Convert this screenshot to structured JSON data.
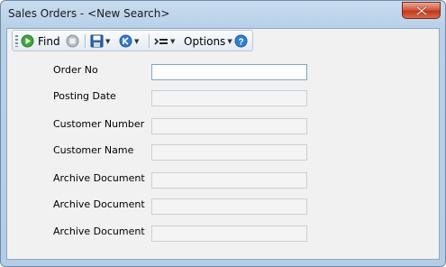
{
  "window": {
    "title": "Sales Orders - <New Search>"
  },
  "toolbar": {
    "find_label": "Find",
    "options_label": "Options",
    "icons": [
      "play-green-icon",
      "stop-gray-icon",
      "save-disk-icon",
      "circle-k-icon",
      "indent-list-icon",
      "help-icon"
    ]
  },
  "form": {
    "fields": [
      {
        "label": "Order No",
        "value": ""
      },
      {
        "label": "Posting Date",
        "value": ""
      },
      {
        "label": "Customer Number",
        "value": ""
      },
      {
        "label": "Customer Name",
        "value": ""
      },
      {
        "label": "Archive Document",
        "value": ""
      },
      {
        "label": "Archive Document",
        "value": ""
      },
      {
        "label": "Archive Document",
        "value": ""
      }
    ]
  },
  "colors": {
    "accent": "#2f7fd0",
    "close": "#c2391b"
  }
}
